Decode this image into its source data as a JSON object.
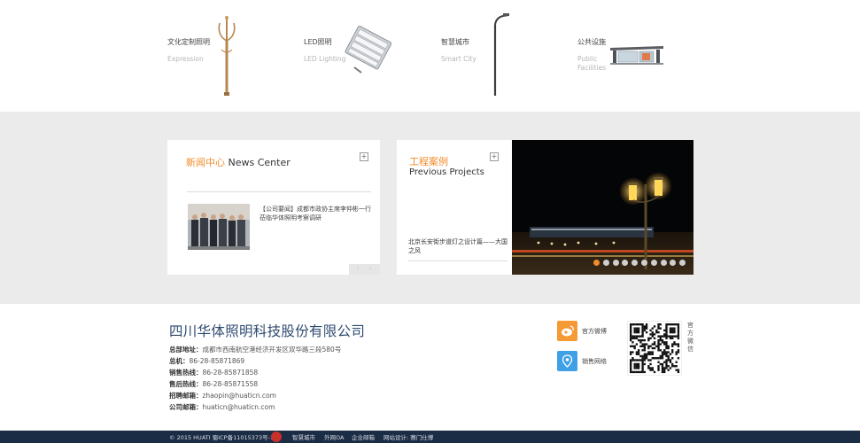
{
  "categories": [
    {
      "zh": "文化定制照明",
      "en": "Expression",
      "icon": "ornate-lamp-post-icon"
    },
    {
      "zh": "LED照明",
      "en": "LED Lighting",
      "icon": "led-floodlight-icon"
    },
    {
      "zh": "智慧城市",
      "en": "Smart City",
      "icon": "smart-street-light-icon"
    },
    {
      "zh": "公共设施",
      "en": "Public Facilities",
      "icon": "bus-shelter-icon"
    }
  ],
  "news": {
    "title_zh": "新闻中心",
    "title_en": "News Center",
    "more": "+",
    "item_text": "【公司要闻】成都市政协主席李仲彬一行莅临华体照明考察调研",
    "pager_prev": "‹",
    "pager_next": "›"
  },
  "projects": {
    "title_zh": "工程案例",
    "title_en": "Previous Projects",
    "more": "+",
    "caption": "北京长安街步道灯之设计篇——大国之风",
    "slide_count": 10,
    "active_slide": 1
  },
  "footer": {
    "company": "四川华体照明科技股份有限公司",
    "address_label": "总部地址：",
    "address": "成都市西南航空港经济开发区双华路三段580号",
    "phone_label": "总机：",
    "phone": "86-28-85871869",
    "sales_label": "销售热线：",
    "sales": "86-28-85871858",
    "service_label": "售后热线：",
    "service": "86-28-85871558",
    "hr_label": "招聘邮箱：",
    "hr": "zhaopin@huaticn.com",
    "mail_label": "公司邮箱：",
    "mail": "huaticn@huaticn.com",
    "weibo_label": "官方微博",
    "network_label": "销售网络",
    "qr_label": "官方微信"
  },
  "bottom": {
    "copyright": "© 2015 HUATI 蜀ICP备11015373号-1",
    "links": [
      "智慧城市",
      "外网OA",
      "企业邮箱",
      "网站设计: 赛门仕博"
    ]
  },
  "colors": {
    "accent": "#f08c2a",
    "brand_blue": "#2d4a70",
    "footer_bar": "#1b2c45",
    "band": "#ebebeb"
  }
}
